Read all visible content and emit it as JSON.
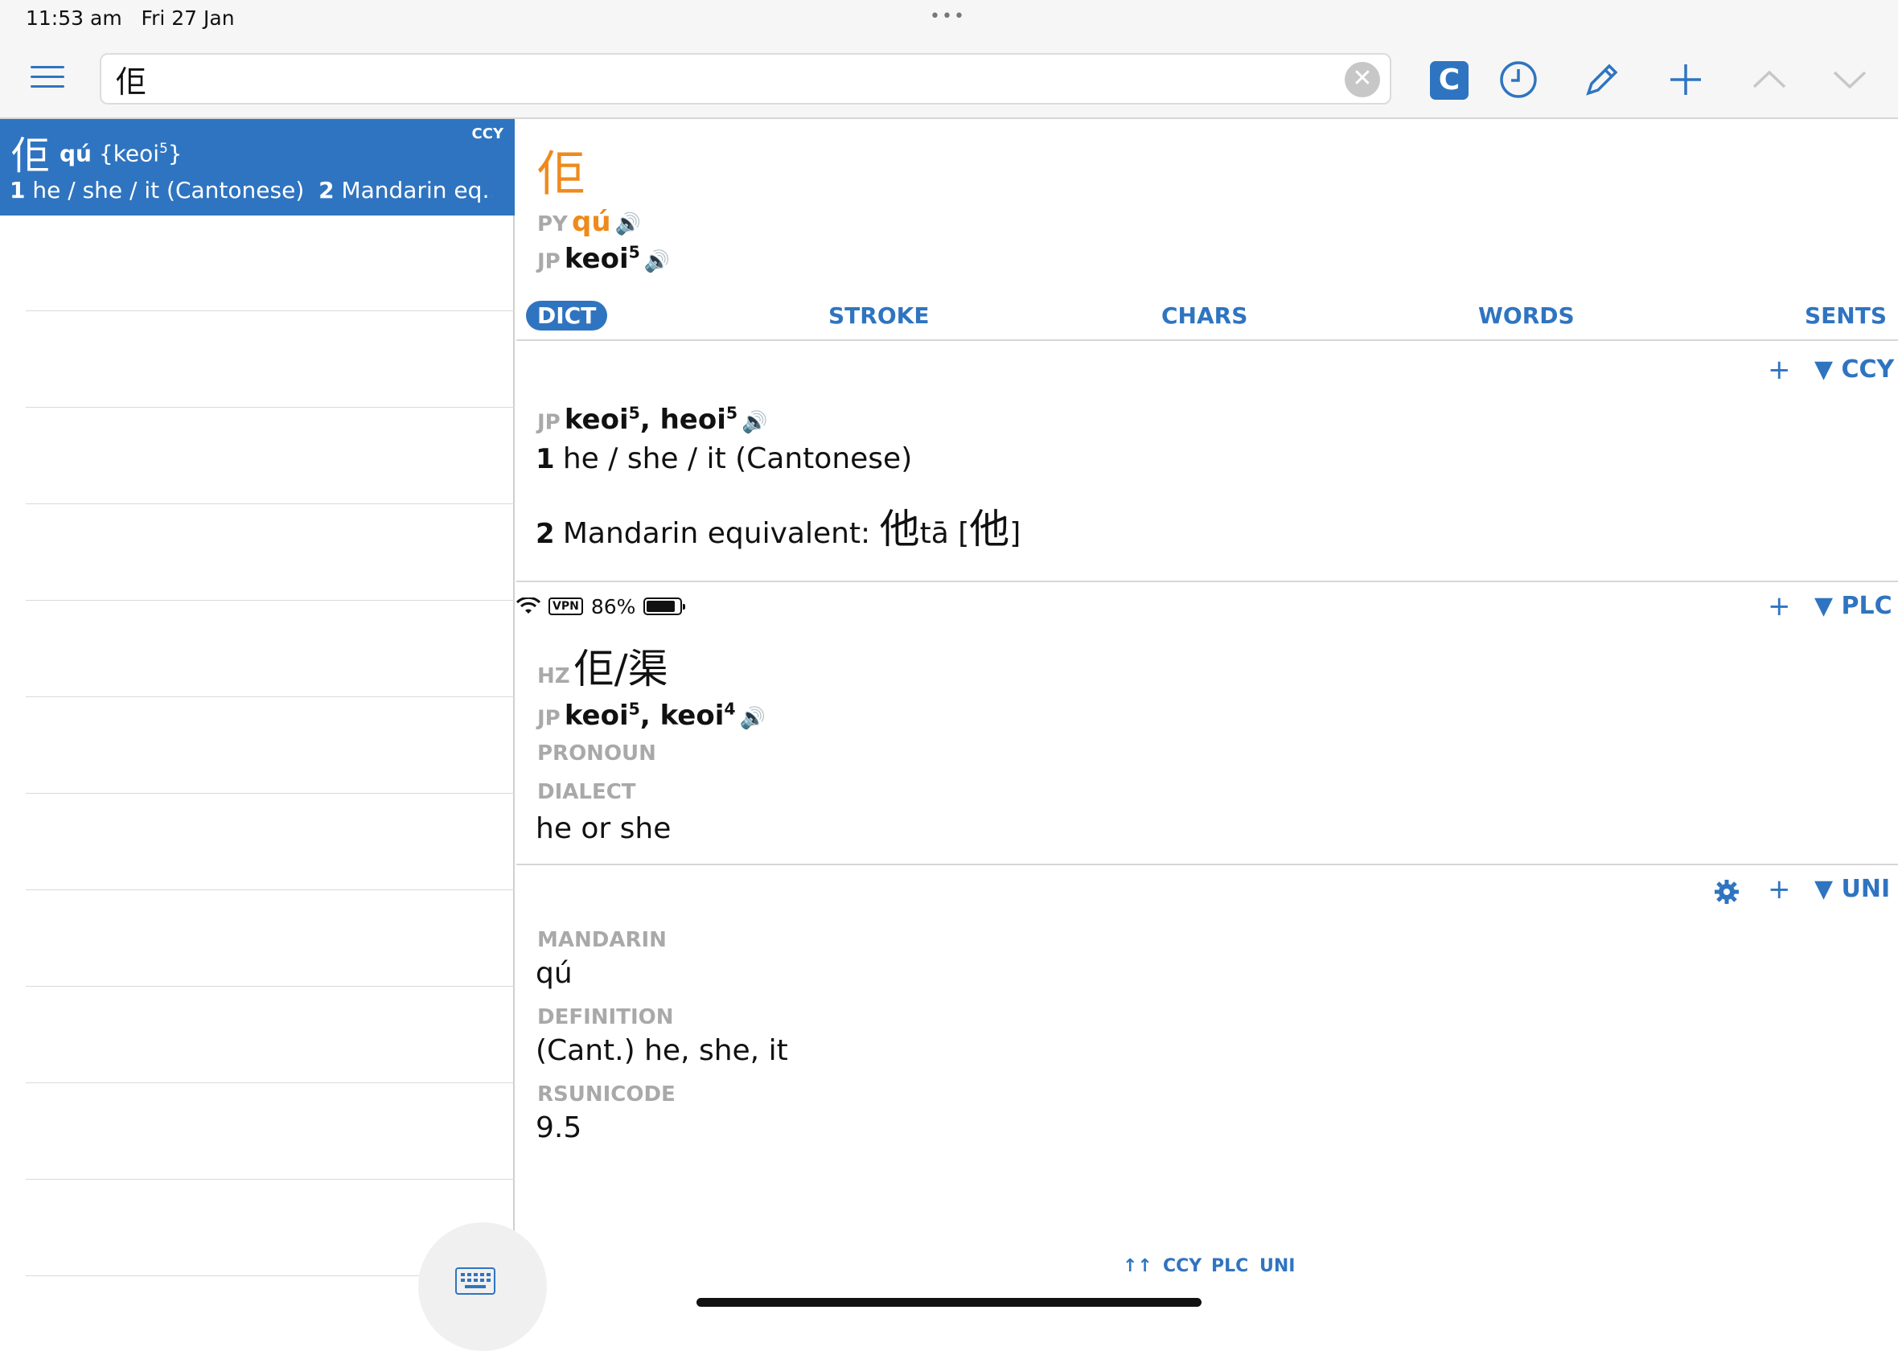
{
  "status": {
    "time": "11:53 am",
    "date": "Fri 27 Jan",
    "dots": "•••",
    "vpn": "VPN",
    "battery": "86%",
    "battery_level": 0.86
  },
  "toolbar": {
    "search_value": "佢",
    "c_label": "C"
  },
  "list": {
    "selected": {
      "han": "佢",
      "pinyin": "qú",
      "jyutping": "{keoi",
      "jyutping_tone": "5",
      "jyutping_end": "}",
      "tag": "CCY",
      "def1_num": "1",
      "def1": "he / she / it (Cantonese)",
      "def2_num": "2",
      "def2": "Mandarin eq…"
    }
  },
  "entry": {
    "headword": "佢",
    "py_label": "PY",
    "py_value": "qú",
    "jp_label": "JP",
    "jp_value": "keoi",
    "jp_tone": "5"
  },
  "tabs": [
    "DICT",
    "STROKE",
    "CHARS",
    "WORDS",
    "SENTS"
  ],
  "sections": {
    "ccy": {
      "plus": "+",
      "name": "▼ CCY",
      "jp_label": "JP",
      "jp1": "keoi",
      "jp1_tone": "5",
      "sep": ", ",
      "jp2": "heoi",
      "jp2_tone": "5",
      "def1_num": "1",
      "def1": "he / she / it (Cantonese)",
      "def2_num": "2",
      "def2_text": "Mandarin equivalent: ",
      "def2_han": "他",
      "def2_py": "tā [",
      "def2_han2": "他",
      "def2_close": "]"
    },
    "plc": {
      "plus": "+",
      "name": "▼ PLC",
      "hz_label": "HZ",
      "hz_value": "佢/渠",
      "jp_label": "JP",
      "jp1": "keoi",
      "jp1_tone": "5",
      "sep": ", ",
      "jp2": "keoi",
      "jp2_tone": "4",
      "pos": "PRONOUN",
      "register": "DIALECT",
      "gloss": "he or she"
    },
    "uni": {
      "plus": "+",
      "name": "▼ UNI",
      "mandarin_label": "MANDARIN",
      "mandarin": "qú",
      "definition_label": "DEFINITION",
      "definition": "(Cant.) he, she, it",
      "rsunicode_label": "RSUNICODE",
      "rsunicode": "9.5"
    }
  },
  "bottom_links": {
    "up": "↑↑",
    "ccy": "CCY",
    "plc": "PLC",
    "uni": "UNI"
  }
}
